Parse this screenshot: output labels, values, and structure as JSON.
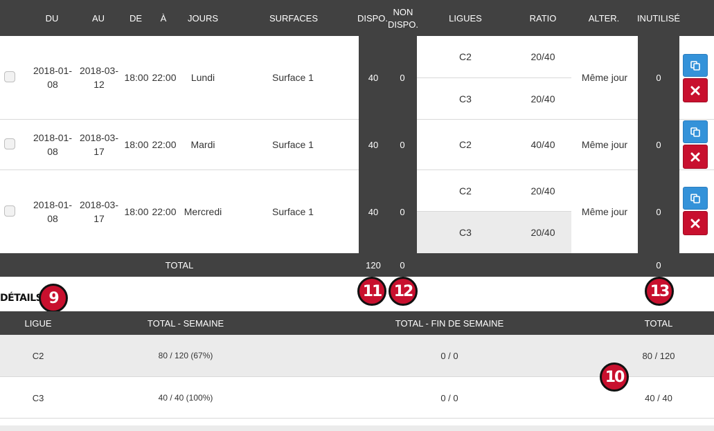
{
  "header": {
    "du": "DU",
    "au": "AU",
    "de": "DE",
    "a": "À",
    "jours": "JOURS",
    "surfaces": "SURFACES",
    "dispo": "DISPO.",
    "non_dispo_1": "NON",
    "non_dispo_2": "DISPO.",
    "ligues": "LIGUES",
    "ratio": "RATIO",
    "alter": "ALTER.",
    "inutilise": "INUTILISÉ"
  },
  "rows": [
    {
      "du_1": "2018-01-",
      "du_2": "08",
      "au_1": "2018-03-",
      "au_2": "12",
      "de": "18:00",
      "a": "22:00",
      "jour": "Lundi",
      "surface": "Surface 1",
      "dispo": "40",
      "non_dispo": "0",
      "leagues": [
        {
          "ligue": "C2",
          "ratio": "20/40"
        },
        {
          "ligue": "C3",
          "ratio": "20/40"
        }
      ],
      "alter": "Même jour",
      "inutilise": "0"
    },
    {
      "du_1": "2018-01-",
      "du_2": "08",
      "au_1": "2018-03-",
      "au_2": "17",
      "de": "18:00",
      "a": "22:00",
      "jour": "Mardi",
      "surface": "Surface 1",
      "dispo": "40",
      "non_dispo": "0",
      "leagues": [
        {
          "ligue": "C2",
          "ratio": "40/40"
        }
      ],
      "alter": "Même jour",
      "inutilise": "0"
    },
    {
      "du_1": "2018-01-",
      "du_2": "08",
      "au_1": "2018-03-",
      "au_2": "17",
      "de": "18:00",
      "a": "22:00",
      "jour": "Mercredi",
      "surface": "Surface 1",
      "dispo": "40",
      "non_dispo": "0",
      "leagues": [
        {
          "ligue": "C2",
          "ratio": "20/40"
        },
        {
          "ligue": "C3",
          "ratio": "20/40"
        }
      ],
      "alter": "Même jour",
      "inutilise": "0"
    }
  ],
  "total_row": {
    "label": "TOTAL",
    "dispo": "120",
    "non_dispo": "0",
    "inutilise": "0"
  },
  "details": {
    "title": "DÉTAILS",
    "headers": {
      "ligue": "LIGUE",
      "total_semaine": "TOTAL - SEMAINE",
      "total_fin_semaine": "TOTAL - FIN DE SEMAINE",
      "total": "TOTAL"
    },
    "rows": [
      {
        "ligue": "C2",
        "total_semaine": "80 / 120 (67%)",
        "total_fin_semaine": "0 / 0",
        "total": "80 / 120"
      },
      {
        "ligue": "C3",
        "total_semaine": "40 / 40 (100%)",
        "total_fin_semaine": "0 / 0",
        "total": "40 / 40"
      }
    ]
  },
  "annotations": {
    "n9": "9",
    "n10": "10",
    "n11": "11",
    "n12": "12",
    "n13": "13"
  },
  "icons": {
    "copy": "copy-icon",
    "delete": "delete-icon"
  },
  "colors": {
    "header_bg": "#414141",
    "copy_button": "#3492d9",
    "delete_button": "#c8102e",
    "badge": "#c8102e",
    "highlight_row": "#ebebeb"
  }
}
